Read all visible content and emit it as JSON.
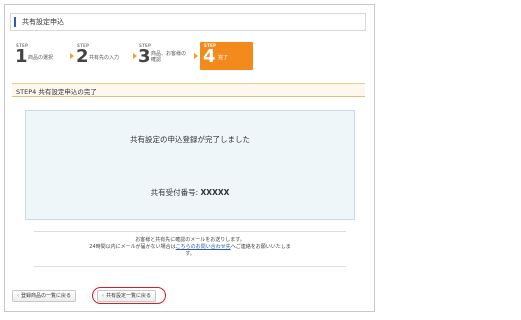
{
  "page_title": "共有設定申込",
  "steps": [
    {
      "label": "STEP",
      "number": "1",
      "name": "商品の選択"
    },
    {
      "label": "STEP",
      "number": "2",
      "name": "共有先の入力"
    },
    {
      "label": "STEP",
      "number": "3",
      "name_line1": "商品、お客様の",
      "name_line2": "確認"
    },
    {
      "label": "STEP",
      "number": "4",
      "name": "完了"
    }
  ],
  "section_title": "STEP4  共有設定申込の完了",
  "completion": {
    "message": "共有設定の申込登録が完了しました",
    "receipt_label": "共有受付番号:",
    "receipt_value": "XXXXX"
  },
  "notice": {
    "line1": "お客様と共有先に確認のメールをお送りします。",
    "line2_pre": "24時間以内にメールが届かない場合は",
    "line2_link": "こちらのお問い合わせ先",
    "line2_post": "へご連絡をお願いいたしま",
    "line3": "す。"
  },
  "buttons": {
    "back_to_list": "登録商品の一覧に戻る",
    "back_to_share_list": "共有設定一覧に戻る",
    "chevron": "‹"
  },
  "colors": {
    "accent": "#f28a1c",
    "link": "#2a5db0",
    "highlight_circle": "#d0202a"
  }
}
